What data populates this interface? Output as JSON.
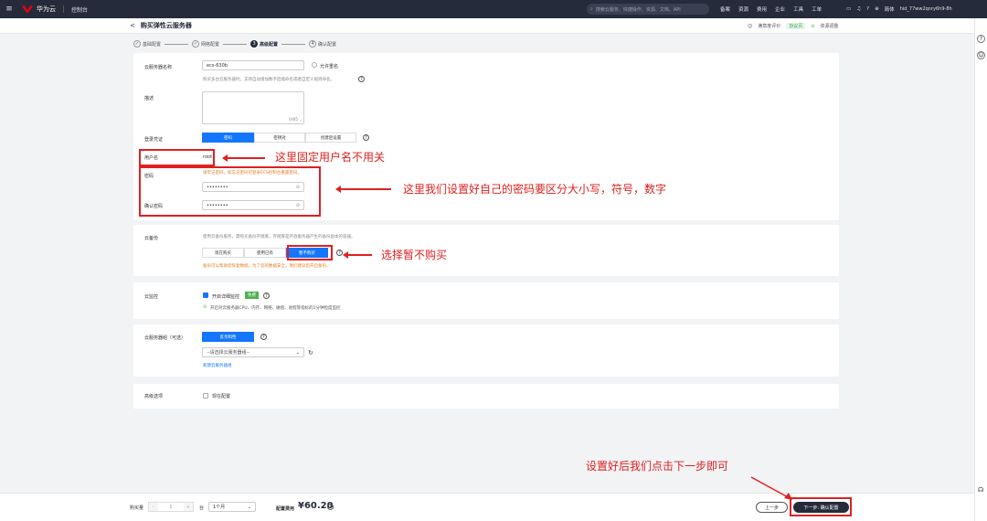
{
  "topbar": {
    "brand": "华为云",
    "console": "控制台",
    "search_placeholder": "搜索云服务、快捷操作、资源、文档、API",
    "links": [
      "备案",
      "资源",
      "费用",
      "企业",
      "工具",
      "工单"
    ],
    "lang": "简体",
    "user": "hid_77ww2qnry6h9-8h"
  },
  "header": {
    "back": "<",
    "title": "购买弹性云服务器",
    "satisfaction": "满意度评价",
    "tag": "协议页",
    "promo": "资源调整"
  },
  "steps": [
    {
      "num": "✓",
      "label": "基础配置"
    },
    {
      "num": "✓",
      "label": "网络配置"
    },
    {
      "num": "3",
      "label": "高级配置"
    },
    {
      "num": "4",
      "label": "确认配置"
    }
  ],
  "server": {
    "name_label": "云服务器名称",
    "name_value": "ecs-630b",
    "allow_dup": "允许重名",
    "name_hint": "购买多台云服务器时，支持自动增加数字后缀命名或者自定义规则命名。",
    "desc_label": "描述",
    "desc_count": "0/85 ⌟",
    "login_label": "登录凭证",
    "login_options": [
      "密码",
      "密钥对",
      "创建后设置"
    ],
    "user_label": "用户名",
    "user_value": "root",
    "pwd_label": "密码",
    "pwd_warn": "请牢记密码，如忘记密码可登录ECS控制台重置密码。",
    "pwd_value": "••••••••",
    "confirm_label": "确认密码",
    "confirm_value": "••••••••",
    "eye": "⊘"
  },
  "backup": {
    "label": "云备份",
    "hint": "使用云备份服务，需购买备份存储库，存储库是存放服务器产生的备份副本的容器。",
    "options": [
      "现在购买",
      "使用已有",
      "暂不购买"
    ],
    "warn": "备份可以帮助您恢复数据，为了您的数据安全，我们建议您开启备份。"
  },
  "monitor": {
    "label": "云监控",
    "enable": "开启详细监控",
    "free": "免费",
    "hint": "开启对云服务器CPU、内存、网络、磁盘、进程等指标的1分钟粒度监控"
  },
  "group": {
    "label": "云服务器组（可选）",
    "option": "反亲和性",
    "select": "--请选择云服务器组--",
    "create": "新建云服务器组"
  },
  "advanced": {
    "label": "高级选项",
    "option": "现在配置"
  },
  "annotations": {
    "user_note": "这里固定用户名不用关",
    "pwd_note": "这里我们设置好自己的密码要区分大小写，符号，数字",
    "backup_note": "选择暂不购买",
    "next_note": "设置好后我们点击下一步即可"
  },
  "bottom": {
    "qty_label": "购买量",
    "qty_minus": "-",
    "qty_value": "1",
    "qty_plus": "+",
    "unit": "台",
    "duration": "1个月",
    "price_label": "配置费用",
    "price": "¥60.20",
    "prev": "上一步",
    "next": "下一步: 确认配置"
  }
}
